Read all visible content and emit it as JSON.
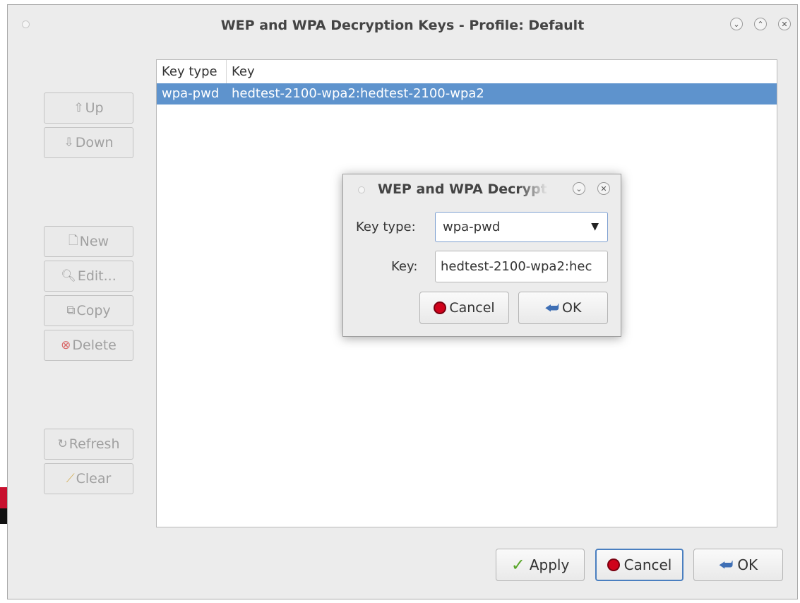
{
  "window": {
    "title": "WEP and WPA Decryption Keys - Profile: Default",
    "controls": {
      "minimize": "chevron-down-icon",
      "maximize": "chevron-up-icon",
      "close": "close-icon"
    }
  },
  "table": {
    "columns": [
      "Key type",
      "Key"
    ],
    "rows": [
      {
        "key_type": "wpa-pwd",
        "key": "hedtest-2100-wpa2:hedtest-2100-wpa2",
        "selected": true
      }
    ]
  },
  "side_buttons": {
    "up": {
      "label": "Up",
      "icon": "arrow-up-icon",
      "enabled": false
    },
    "down": {
      "label": "Down",
      "icon": "arrow-down-icon",
      "enabled": false
    },
    "new": {
      "label": "New",
      "icon": "new-document-icon",
      "enabled": false
    },
    "edit": {
      "label": "Edit...",
      "icon": "edit-icon",
      "enabled": false
    },
    "copy": {
      "label": "Copy",
      "icon": "copy-icon",
      "enabled": false
    },
    "delete": {
      "label": "Delete",
      "icon": "delete-icon",
      "enabled": false
    },
    "refresh": {
      "label": "Refresh",
      "icon": "refresh-icon",
      "enabled": false
    },
    "clear": {
      "label": "Clear",
      "icon": "broom-icon",
      "enabled": false
    }
  },
  "footer": {
    "apply": "Apply",
    "cancel": "Cancel",
    "ok": "OK"
  },
  "dialog": {
    "title": "WEP and WPA Decrypt",
    "key_type_label": "Key type:",
    "key_type_value": "wpa-pwd",
    "key_label": "Key:",
    "key_value": "hedtest-2100-wpa2:hec",
    "cancel": "Cancel",
    "ok": "OK"
  },
  "colors": {
    "selection": "#5e93cd",
    "window_bg": "#ececec",
    "focus_border": "#4a7fc0",
    "stop_red": "#d0021b",
    "apply_green": "#5aa62a"
  }
}
